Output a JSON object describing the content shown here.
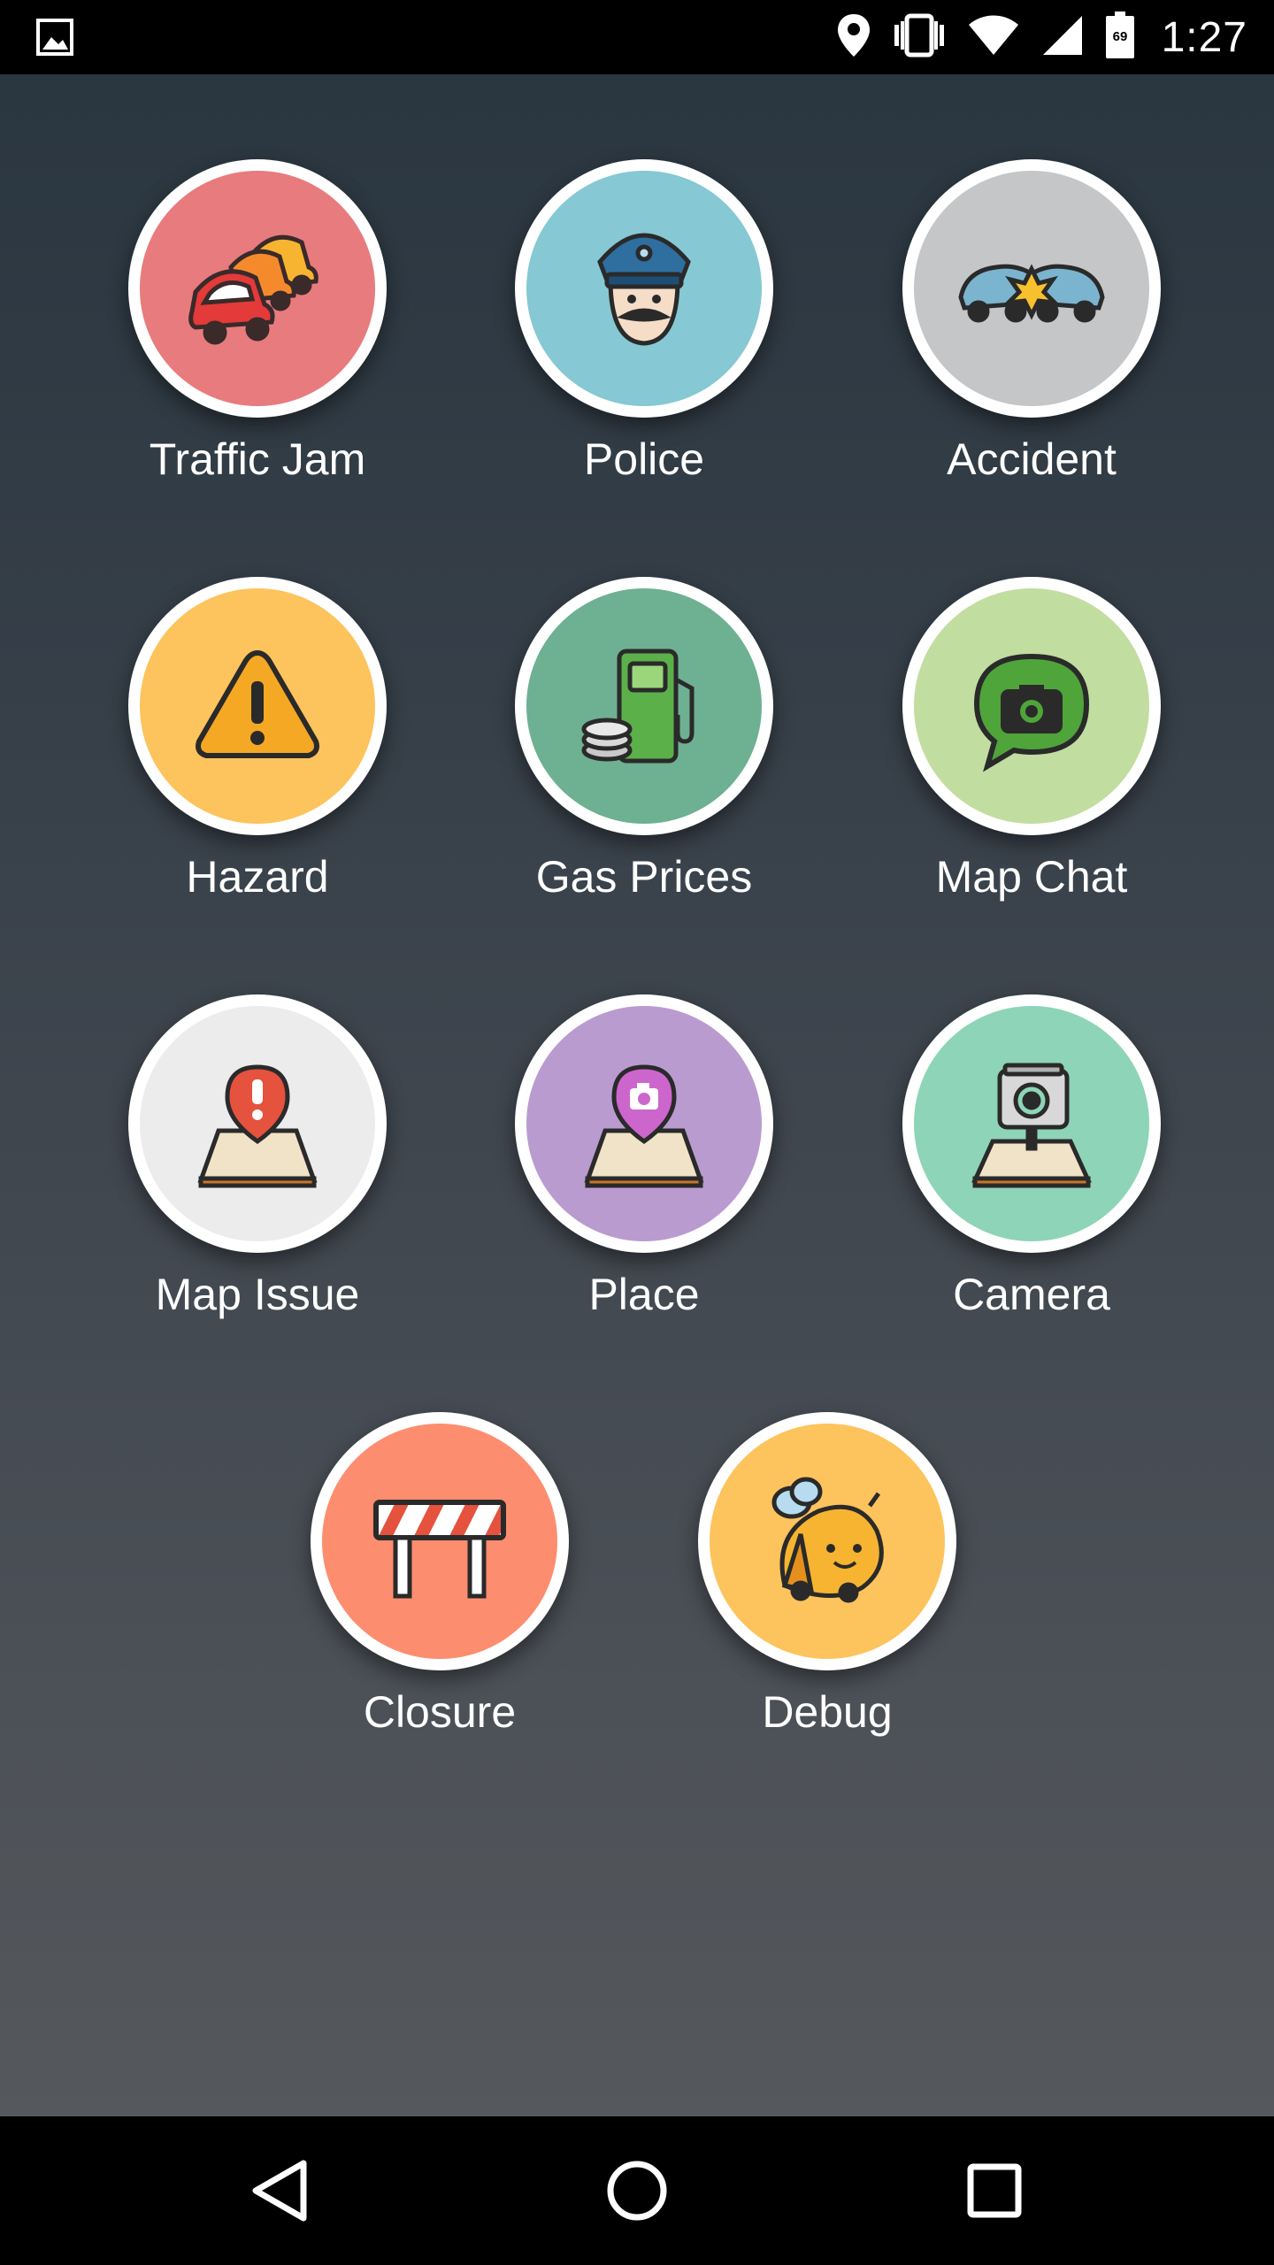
{
  "status_bar": {
    "time": "1:27",
    "battery_level": "69",
    "icons": [
      "image-icon",
      "location-icon",
      "vibrate-icon",
      "wifi-icon",
      "signal-icon",
      "battery-icon"
    ]
  },
  "report_menu": {
    "items": [
      {
        "label": "Traffic Jam",
        "icon": "traffic-jam-icon",
        "color": "#e87b7d"
      },
      {
        "label": "Police",
        "icon": "police-icon",
        "color": "#86c8d3"
      },
      {
        "label": "Accident",
        "icon": "accident-icon",
        "color": "#c4c6c8"
      },
      {
        "label": "Hazard",
        "icon": "hazard-icon",
        "color": "#fdc35d"
      },
      {
        "label": "Gas Prices",
        "icon": "gas-prices-icon",
        "color": "#6eb092"
      },
      {
        "label": "Map Chat",
        "icon": "map-chat-icon",
        "color": "#c2dda0"
      },
      {
        "label": "Map Issue",
        "icon": "map-issue-icon",
        "color": "#ececec"
      },
      {
        "label": "Place",
        "icon": "place-icon",
        "color": "#b99bd0"
      },
      {
        "label": "Camera",
        "icon": "camera-icon",
        "color": "#8ed4b8"
      },
      {
        "label": "Closure",
        "icon": "closure-icon",
        "color": "#fd8d6f"
      },
      {
        "label": "Debug",
        "icon": "debug-icon",
        "color": "#fdc35d"
      }
    ]
  },
  "nav_bar": {
    "icons": [
      "back-icon",
      "home-icon",
      "recents-icon"
    ]
  }
}
